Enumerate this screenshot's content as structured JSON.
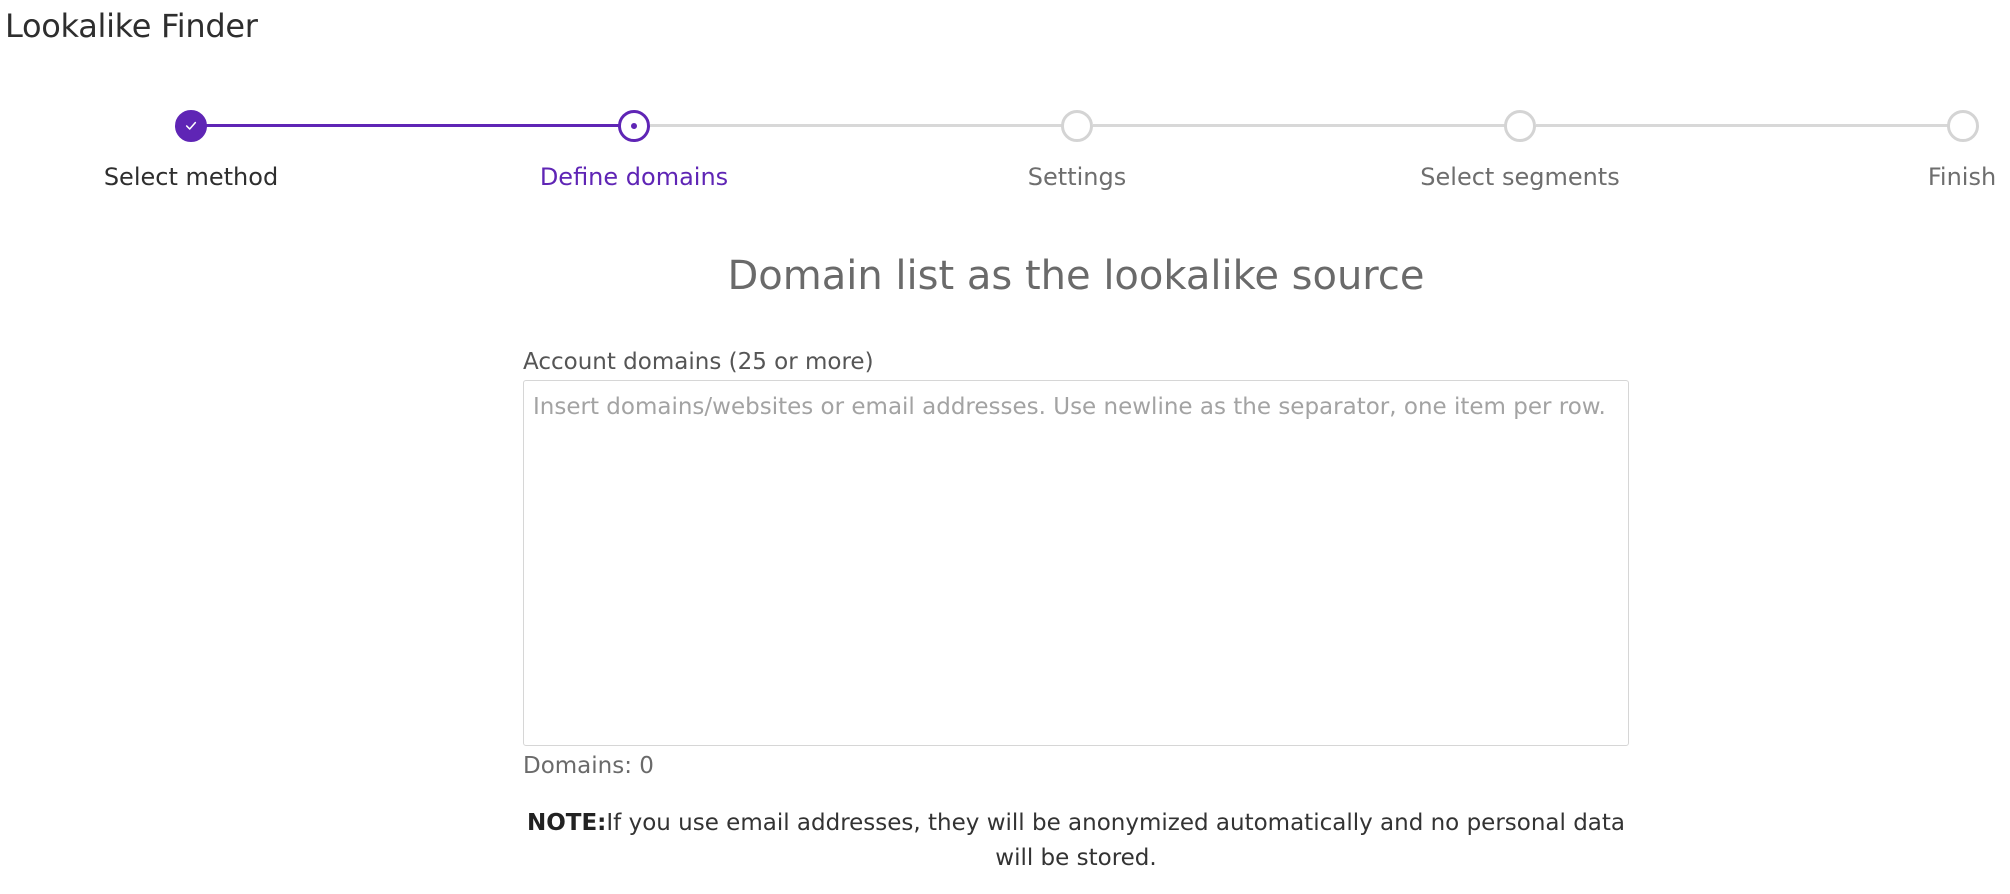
{
  "app": {
    "title": "Lookalike Finder"
  },
  "stepper": {
    "steps": [
      {
        "label": "Select method",
        "state": "completed"
      },
      {
        "label": "Define domains",
        "state": "current"
      },
      {
        "label": "Settings",
        "state": "pending"
      },
      {
        "label": "Select segments",
        "state": "pending"
      },
      {
        "label": "Finish",
        "state": "pending"
      }
    ],
    "colors": {
      "active": "#5f25b5",
      "inactive": "#d4d4d4"
    }
  },
  "main": {
    "section_title": "Domain list as the lookalike source",
    "field_label": "Account domains (25 or more)",
    "textarea": {
      "value": "",
      "placeholder": "Insert domains/websites or email addresses. Use newline as the separator, one item per row."
    },
    "domain_count": "Domains: 0",
    "note": {
      "prefix": "NOTE:",
      "text": "If you use email addresses, they will be anonymized automatically and no personal data will be stored."
    }
  },
  "icons": {
    "completed_step": "check-icon",
    "current_step": "dot-icon"
  }
}
